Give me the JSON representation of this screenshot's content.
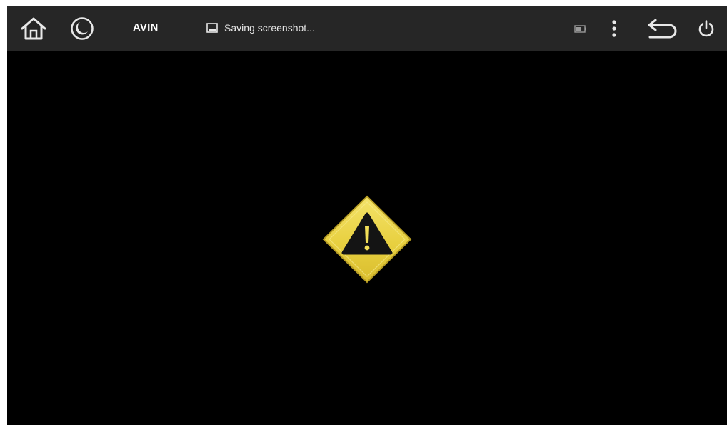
{
  "status_bar": {
    "app_title": "AVIN",
    "notification_text": "Saving screenshot...",
    "icons": {
      "home": "home-icon",
      "night_mode": "moon-icon",
      "notification": "image-icon",
      "battery": "battery-icon",
      "menu": "more-vert-icon",
      "back": "back-icon",
      "power": "power-icon"
    }
  },
  "main": {
    "signal_state": "warning-icon"
  },
  "colors": {
    "bar_background": "#262626",
    "screen_background": "#000000",
    "warning_yellow": "#ecd64a"
  }
}
